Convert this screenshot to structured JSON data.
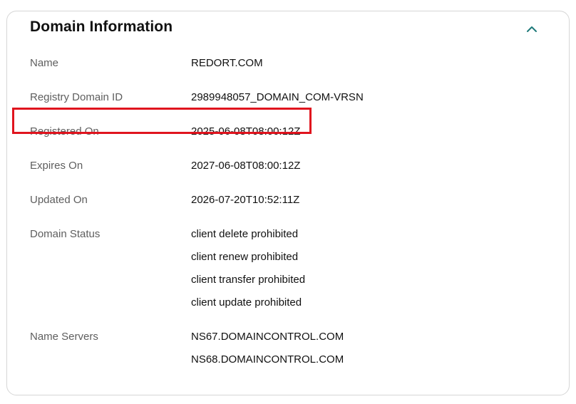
{
  "card": {
    "title": "Domain Information",
    "collapse_icon": "chevron-up-icon",
    "accent_color": "#1f7a7a"
  },
  "fields": {
    "name": {
      "label": "Name",
      "value": "REDORT.COM"
    },
    "registry_domain_id": {
      "label": "Registry Domain ID",
      "value": "2989948057_DOMAIN_COM-VRSN"
    },
    "registered_on": {
      "label": "Registered On",
      "value": "2025-06-08T08:00:12Z"
    },
    "expires_on": {
      "label": "Expires On",
      "value": "2027-06-08T08:00:12Z"
    },
    "updated_on": {
      "label": "Updated On",
      "value": "2026-07-20T10:52:11Z"
    },
    "domain_status": {
      "label": "Domain Status",
      "values": [
        "client delete prohibited",
        "client renew prohibited",
        "client transfer prohibited",
        "client update prohibited"
      ]
    },
    "name_servers": {
      "label": "Name Servers",
      "values": [
        "NS67.DOMAINCONTROL.COM",
        "NS68.DOMAINCONTROL.COM"
      ]
    }
  },
  "highlight": {
    "target": "registered_on",
    "color": "#e0141e"
  }
}
